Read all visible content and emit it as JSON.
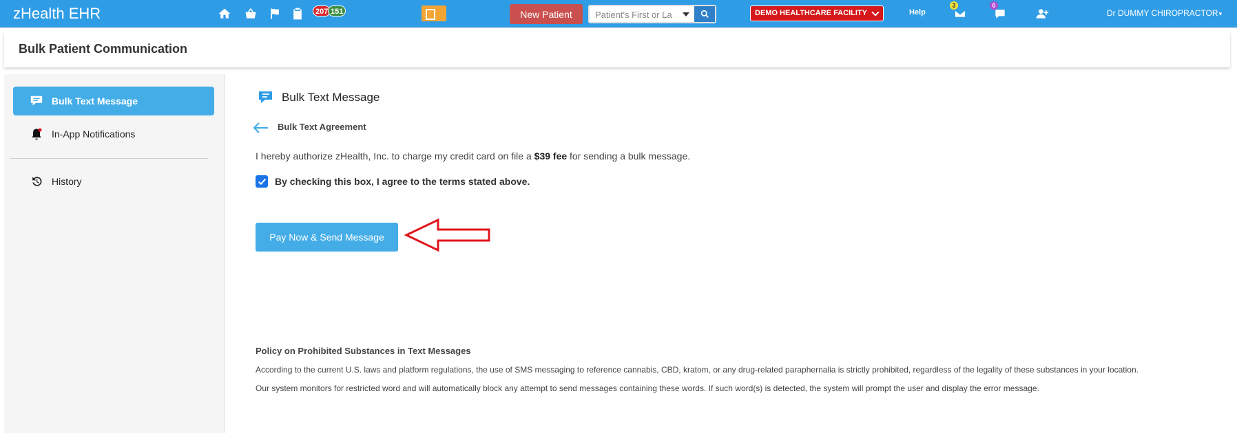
{
  "app": {
    "brand": "zHealth EHR"
  },
  "topbar": {
    "icons": [
      "home-icon",
      "basket-icon",
      "flag-icon",
      "clipboard-icon"
    ],
    "badge_red": "207",
    "badge_green": "151",
    "new_patient_label": "New Patient",
    "search_placeholder": "Patient's First or La",
    "facility": "DEMO HEALTHCARE FACILITY",
    "help": "Help",
    "mail_count": "3",
    "chat_count": "0",
    "user": "Dr DUMMY CHIROPRACTOR"
  },
  "page": {
    "title": "Bulk Patient Communication"
  },
  "sidebar": {
    "items": [
      {
        "label": "Bulk Text Message",
        "icon": "chat-bubble-icon",
        "active": true
      },
      {
        "label": "In-App Notifications",
        "icon": "bell-icon",
        "active": false
      },
      {
        "label": "History",
        "icon": "history-icon",
        "active": false
      }
    ]
  },
  "main": {
    "title": "Bulk Text Message",
    "agreement_title": "Bulk Text Agreement",
    "auth_prefix": "I hereby authorize zHealth, Inc. to charge my credit card on file a ",
    "auth_fee": "$39 fee",
    "auth_suffix": " for sending a bulk message.",
    "agree_label": "By checking this box, I agree to the terms stated above.",
    "agree_checked": true,
    "pay_button": "Pay Now & Send Message",
    "policy_title": "Policy on Prohibited Substances in Text Messages",
    "policy_line1": "According to the current U.S. laws and platform regulations, the use of SMS messaging to reference cannabis, CBD, kratom, or any drug-related paraphernalia is strictly prohibited, regardless of the legality of these substances in your location.",
    "policy_line2": "Our system monitors for restricted word and will automatically block any attempt to send messages containing these words. If such word(s) is detected, the system will prompt the user and display the error message."
  },
  "colors": {
    "topbar": "#2f9ce6",
    "accent": "#44ade8",
    "new_patient": "#c9504e",
    "facility": "#d4181b",
    "annotation_arrow": "#e0141b"
  }
}
